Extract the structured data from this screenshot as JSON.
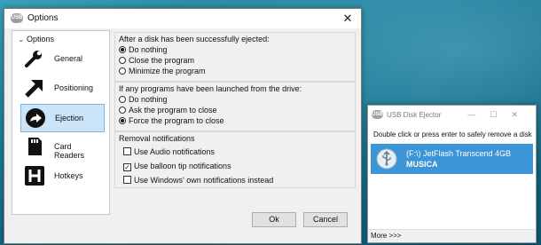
{
  "options_window": {
    "title": "Options",
    "close_glyph": "✕",
    "sidebar": {
      "header": "Options",
      "items": [
        {
          "label": "General",
          "icon": "wrench-icon",
          "selected": false
        },
        {
          "label": "Positioning",
          "icon": "arrow-up-right-icon",
          "selected": false
        },
        {
          "label": "Ejection",
          "icon": "eject-arrow-icon",
          "selected": true
        },
        {
          "label": "Card Readers",
          "icon": "sd-card-icon",
          "selected": false
        },
        {
          "label": "Hotkeys",
          "icon": "hotkey-h-icon",
          "selected": false
        }
      ]
    },
    "after_eject": {
      "title": "After a disk has been successfully ejected:",
      "options": [
        {
          "label": "Do nothing",
          "checked": true
        },
        {
          "label": "Close the program",
          "checked": false
        },
        {
          "label": "Minimize the program",
          "checked": false
        }
      ]
    },
    "programs_launched": {
      "title": "If any programs have been launched from the drive:",
      "options": [
        {
          "label": "Do nothing",
          "checked": false
        },
        {
          "label": "Ask the program to close",
          "checked": false
        },
        {
          "label": "Force the program to close",
          "checked": true
        }
      ]
    },
    "notifications": {
      "title": "Removal notifications",
      "options": [
        {
          "label": "Use Audio notifications",
          "checked": false
        },
        {
          "label": "Use balloon tip notifications",
          "checked": true
        },
        {
          "label": "Use Windows' own notifications instead",
          "checked": false
        }
      ]
    },
    "ok_label": "Ok",
    "cancel_label": "Cancel"
  },
  "ejector_window": {
    "title": "USB Disk Ejector",
    "hint": "Double click or press enter to safely remove a disk",
    "drive": {
      "name": "(F:\\) JetFlash Transcend 4GB",
      "label": "MUSICA"
    },
    "more_label": "More >>>"
  },
  "colors": {
    "selection": "#cce4f7",
    "drive_highlight": "#3c95d6",
    "desktop": "#0d5d7c"
  }
}
